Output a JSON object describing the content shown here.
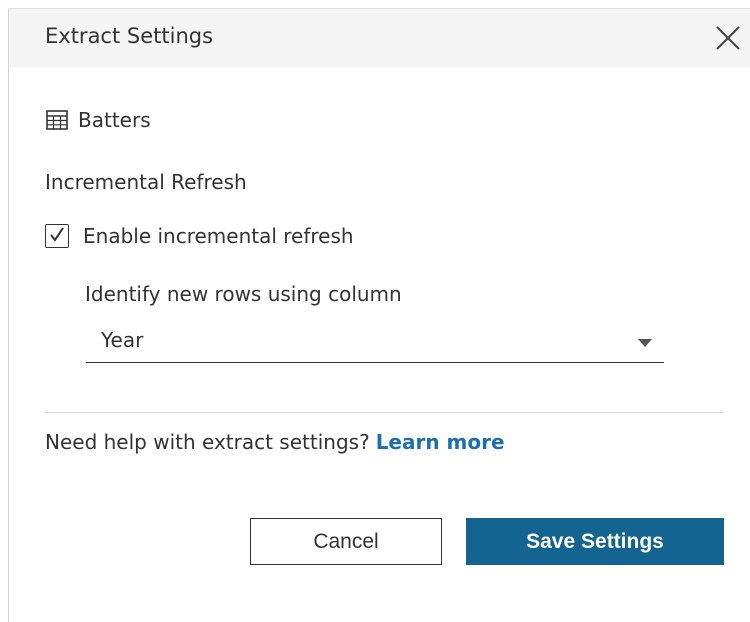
{
  "dialog": {
    "title": "Extract Settings",
    "datasource_name": "Batters",
    "section_title": "Incremental Refresh",
    "checkbox_label": "Enable incremental refresh",
    "checkbox_checked": true,
    "column_label": "Identify new rows using column",
    "column_value": "Year",
    "help_text": "Need help with extract settings?",
    "help_link": "Learn more",
    "cancel_label": "Cancel",
    "save_label": "Save Settings"
  },
  "icons": {
    "close": "close-icon",
    "datasource": "table-icon",
    "checkbox": "checkmark-icon",
    "dropdown": "caret-down-icon"
  },
  "colors": {
    "accent": "#136491",
    "link": "#1f6fae",
    "header_bg": "#f5f5f5"
  }
}
